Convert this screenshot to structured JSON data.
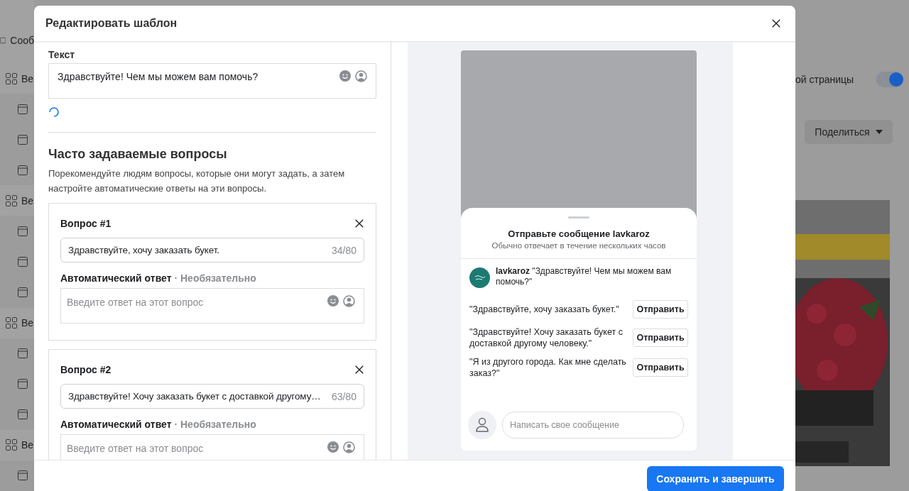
{
  "background": {
    "sidebar_items": [
      {
        "kind": "chat",
        "label": "Сооб"
      },
      {
        "kind": "group",
        "label": "Ве"
      },
      {
        "kind": "page"
      },
      {
        "kind": "page"
      },
      {
        "kind": "page"
      },
      {
        "kind": "group",
        "label": "Ве"
      },
      {
        "kind": "page"
      },
      {
        "kind": "page"
      },
      {
        "kind": "page"
      },
      {
        "kind": "group",
        "label": "Ве"
      },
      {
        "kind": "page"
      },
      {
        "kind": "page"
      },
      {
        "kind": "page"
      },
      {
        "kind": "group",
        "label": "Ве"
      },
      {
        "kind": "page"
      }
    ],
    "right_panel": {
      "label": "ой страницы",
      "toggle_on": true,
      "share_button": "Поделиться"
    }
  },
  "modal": {
    "title": "Редактировать шаблон",
    "text_field": {
      "label": "Текст",
      "value": "Здравствуйте! Чем мы можем вам помочь?"
    },
    "faq": {
      "title": "Часто задаваемые вопросы",
      "description": "Порекомендуйте людям вопросы, которые они могут задать, а затем настройте автоматические ответы на эти вопросы.",
      "questions": [
        {
          "label": "Вопрос #1",
          "value": "Здравствуйте, хочу заказать букет.",
          "counter": "34/80",
          "answer_label": "Автоматический ответ",
          "answer_note": "· Необязательно",
          "answer_placeholder": "Введите ответ на этот вопрос"
        },
        {
          "label": "Вопрос #2",
          "value": "Здравствуйте! Хочу заказать букет с доставкой другому…",
          "counter": "63/80",
          "answer_label": "Автоматический ответ",
          "answer_note": "· Необязательно",
          "answer_placeholder": "Введите ответ на этот вопрос"
        }
      ]
    },
    "preview": {
      "title": "Отправьте сообщение lavkaroz",
      "subtitle": "Обычно отвечает в течение нескольких часов",
      "greeting": "**lavkaroz** \"Здравствуйте! Чем мы можем вам помочь?\"",
      "suggestions": [
        {
          "text": "\"Здравствуйте, хочу заказать букет.\"",
          "button": "Отправить"
        },
        {
          "text": "\"Здравствуйте! Хочу заказать букет с доставкой другому человеку.\"",
          "button": "Отправить"
        },
        {
          "text": "\"Я из другого города. Как мне сделать заказ?\"",
          "button": "Отправить"
        }
      ],
      "composer_placeholder": "Написать свое сообщение"
    },
    "save_button": "Сохранить и завершить"
  }
}
